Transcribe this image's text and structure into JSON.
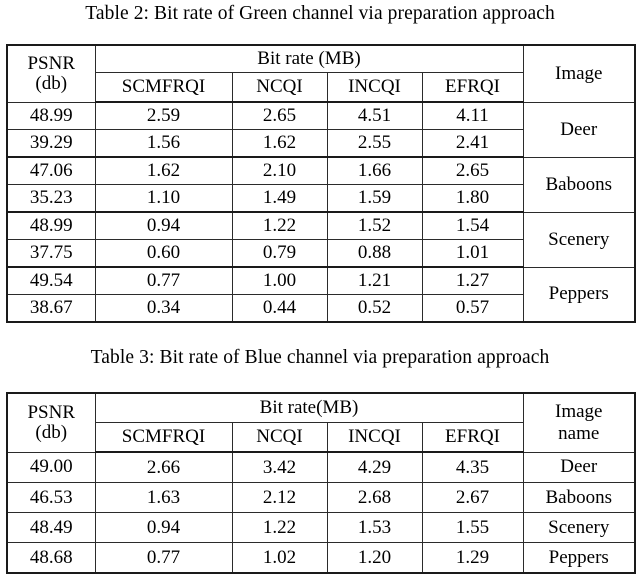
{
  "document": {
    "tables": [
      {
        "id": "table2",
        "caption": "Table 2: Bit rate of Green channel via preparation approach",
        "header": {
          "psnr_line1": "PSNR",
          "psnr_line2": "(db)",
          "group_label": "Bit rate (MB)",
          "columns": [
            "SCMFRQI",
            "NCQI",
            "INCQI",
            "EFRQI"
          ],
          "image_label": "Image"
        },
        "groups": [
          {
            "image": "Deer",
            "rows": [
              {
                "psnr": "48.99",
                "values": [
                  "2.59",
                  "2.65",
                  "4.51",
                  "4.11"
                ]
              },
              {
                "psnr": "39.29",
                "values": [
                  "1.56",
                  "1.62",
                  "2.55",
                  "2.41"
                ]
              }
            ]
          },
          {
            "image": "Baboons",
            "rows": [
              {
                "psnr": "47.06",
                "values": [
                  "1.62",
                  "2.10",
                  "1.66",
                  "2.65"
                ]
              },
              {
                "psnr": "35.23",
                "values": [
                  "1.10",
                  "1.49",
                  "1.59",
                  "1.80"
                ]
              }
            ]
          },
          {
            "image": "Scenery",
            "rows": [
              {
                "psnr": "48.99",
                "values": [
                  "0.94",
                  "1.22",
                  "1.52",
                  "1.54"
                ]
              },
              {
                "psnr": "37.75",
                "values": [
                  "0.60",
                  "0.79",
                  "0.88",
                  "1.01"
                ]
              }
            ]
          },
          {
            "image": "Peppers",
            "rows": [
              {
                "psnr": "49.54",
                "values": [
                  "0.77",
                  "1.00",
                  "1.21",
                  "1.27"
                ]
              },
              {
                "psnr": "38.67",
                "values": [
                  "0.34",
                  "0.44",
                  "0.52",
                  "0.57"
                ]
              }
            ]
          }
        ]
      },
      {
        "id": "table3",
        "caption": "Table 3: Bit rate of Blue channel via preparation approach",
        "header": {
          "psnr_line1": "PSNR",
          "psnr_line2": "(db)",
          "group_label": "Bit rate(MB)",
          "columns": [
            "SCMFRQI",
            "NCQI",
            "INCQI",
            "EFRQI"
          ],
          "image_label_line1": "Image",
          "image_label_line2": "name"
        },
        "rows": [
          {
            "psnr": "49.00",
            "values": [
              "2.66",
              "3.42",
              "4.29",
              "4.35"
            ],
            "image": "Deer"
          },
          {
            "psnr": "46.53",
            "values": [
              "1.63",
              "2.12",
              "2.68",
              "2.67"
            ],
            "image": "Baboons"
          },
          {
            "psnr": "48.49",
            "values": [
              "0.94",
              "1.22",
              "1.53",
              "1.55"
            ],
            "image": "Scenery"
          },
          {
            "psnr": "48.68",
            "values": [
              "0.77",
              "1.02",
              "1.20",
              "1.29"
            ],
            "image": "Peppers"
          }
        ]
      }
    ]
  }
}
